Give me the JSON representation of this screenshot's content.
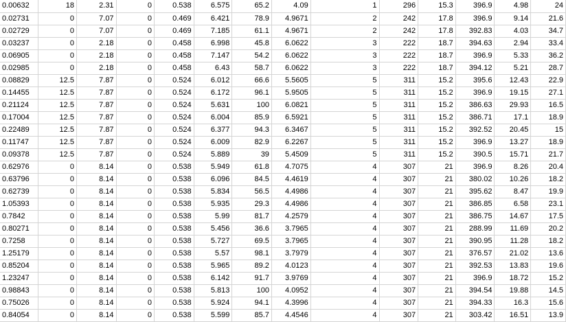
{
  "sheet": {
    "rows": [
      [
        "0.00632",
        "18",
        "2.31",
        "0",
        "0.538",
        "6.575",
        "65.2",
        "4.09",
        "1",
        "296",
        "15.3",
        "396.9",
        "4.98",
        "24"
      ],
      [
        "0.02731",
        "0",
        "7.07",
        "0",
        "0.469",
        "6.421",
        "78.9",
        "4.9671",
        "2",
        "242",
        "17.8",
        "396.9",
        "9.14",
        "21.6"
      ],
      [
        "0.02729",
        "0",
        "7.07",
        "0",
        "0.469",
        "7.185",
        "61.1",
        "4.9671",
        "2",
        "242",
        "17.8",
        "392.83",
        "4.03",
        "34.7"
      ],
      [
        "0.03237",
        "0",
        "2.18",
        "0",
        "0.458",
        "6.998",
        "45.8",
        "6.0622",
        "3",
        "222",
        "18.7",
        "394.63",
        "2.94",
        "33.4"
      ],
      [
        "0.06905",
        "0",
        "2.18",
        "0",
        "0.458",
        "7.147",
        "54.2",
        "6.0622",
        "3",
        "222",
        "18.7",
        "396.9",
        "5.33",
        "36.2"
      ],
      [
        "0.02985",
        "0",
        "2.18",
        "0",
        "0.458",
        "6.43",
        "58.7",
        "6.0622",
        "3",
        "222",
        "18.7",
        "394.12",
        "5.21",
        "28.7"
      ],
      [
        "0.08829",
        "12.5",
        "7.87",
        "0",
        "0.524",
        "6.012",
        "66.6",
        "5.5605",
        "5",
        "311",
        "15.2",
        "395.6",
        "12.43",
        "22.9"
      ],
      [
        "0.14455",
        "12.5",
        "7.87",
        "0",
        "0.524",
        "6.172",
        "96.1",
        "5.9505",
        "5",
        "311",
        "15.2",
        "396.9",
        "19.15",
        "27.1"
      ],
      [
        "0.21124",
        "12.5",
        "7.87",
        "0",
        "0.524",
        "5.631",
        "100",
        "6.0821",
        "5",
        "311",
        "15.2",
        "386.63",
        "29.93",
        "16.5"
      ],
      [
        "0.17004",
        "12.5",
        "7.87",
        "0",
        "0.524",
        "6.004",
        "85.9",
        "6.5921",
        "5",
        "311",
        "15.2",
        "386.71",
        "17.1",
        "18.9"
      ],
      [
        "0.22489",
        "12.5",
        "7.87",
        "0",
        "0.524",
        "6.377",
        "94.3",
        "6.3467",
        "5",
        "311",
        "15.2",
        "392.52",
        "20.45",
        "15"
      ],
      [
        "0.11747",
        "12.5",
        "7.87",
        "0",
        "0.524",
        "6.009",
        "82.9",
        "6.2267",
        "5",
        "311",
        "15.2",
        "396.9",
        "13.27",
        "18.9"
      ],
      [
        "0.09378",
        "12.5",
        "7.87",
        "0",
        "0.524",
        "5.889",
        "39",
        "5.4509",
        "5",
        "311",
        "15.2",
        "390.5",
        "15.71",
        "21.7"
      ],
      [
        "0.62976",
        "0",
        "8.14",
        "0",
        "0.538",
        "5.949",
        "61.8",
        "4.7075",
        "4",
        "307",
        "21",
        "396.9",
        "8.26",
        "20.4"
      ],
      [
        "0.63796",
        "0",
        "8.14",
        "0",
        "0.538",
        "6.096",
        "84.5",
        "4.4619",
        "4",
        "307",
        "21",
        "380.02",
        "10.26",
        "18.2"
      ],
      [
        "0.62739",
        "0",
        "8.14",
        "0",
        "0.538",
        "5.834",
        "56.5",
        "4.4986",
        "4",
        "307",
        "21",
        "395.62",
        "8.47",
        "19.9"
      ],
      [
        "1.05393",
        "0",
        "8.14",
        "0",
        "0.538",
        "5.935",
        "29.3",
        "4.4986",
        "4",
        "307",
        "21",
        "386.85",
        "6.58",
        "23.1"
      ],
      [
        "0.7842",
        "0",
        "8.14",
        "0",
        "0.538",
        "5.99",
        "81.7",
        "4.2579",
        "4",
        "307",
        "21",
        "386.75",
        "14.67",
        "17.5"
      ],
      [
        "0.80271",
        "0",
        "8.14",
        "0",
        "0.538",
        "5.456",
        "36.6",
        "3.7965",
        "4",
        "307",
        "21",
        "288.99",
        "11.69",
        "20.2"
      ],
      [
        "0.7258",
        "0",
        "8.14",
        "0",
        "0.538",
        "5.727",
        "69.5",
        "3.7965",
        "4",
        "307",
        "21",
        "390.95",
        "11.28",
        "18.2"
      ],
      [
        "1.25179",
        "0",
        "8.14",
        "0",
        "0.538",
        "5.57",
        "98.1",
        "3.7979",
        "4",
        "307",
        "21",
        "376.57",
        "21.02",
        "13.6"
      ],
      [
        "0.85204",
        "0",
        "8.14",
        "0",
        "0.538",
        "5.965",
        "89.2",
        "4.0123",
        "4",
        "307",
        "21",
        "392.53",
        "13.83",
        "19.6"
      ],
      [
        "1.23247",
        "0",
        "8.14",
        "0",
        "0.538",
        "6.142",
        "91.7",
        "3.9769",
        "4",
        "307",
        "21",
        "396.9",
        "18.72",
        "15.2"
      ],
      [
        "0.98843",
        "0",
        "8.14",
        "0",
        "0.538",
        "5.813",
        "100",
        "4.0952",
        "4",
        "307",
        "21",
        "394.54",
        "19.88",
        "14.5"
      ],
      [
        "0.75026",
        "0",
        "8.14",
        "0",
        "0.538",
        "5.924",
        "94.1",
        "4.3996",
        "4",
        "307",
        "21",
        "394.33",
        "16.3",
        "15.6"
      ],
      [
        "0.84054",
        "0",
        "8.14",
        "0",
        "0.538",
        "5.599",
        "85.7",
        "4.4546",
        "4",
        "307",
        "21",
        "303.42",
        "16.51",
        "13.9"
      ]
    ]
  }
}
